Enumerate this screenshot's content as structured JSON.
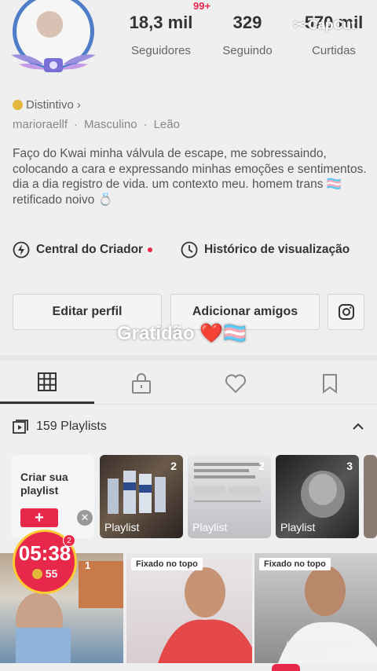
{
  "header": {
    "notification_badge": "99+",
    "watermark": "CapCut",
    "stats": [
      {
        "value": "18,3 mil",
        "label": "Seguidores"
      },
      {
        "value": "329",
        "label": "Seguindo"
      },
      {
        "value": "570 mil",
        "label": "Curtidas"
      }
    ]
  },
  "profile": {
    "badge_label": "Distintivo",
    "username": "marioraellf",
    "gender": "Masculino",
    "sign": "Leão",
    "bio": "Faço do Kwai  minha válvula de escape, me sobressaindo, colocando a cara e expressando minhas emoções e sentimentos.\ndia a dia registro de vida. um contexto meu. homem trans 🏳️‍⚧️ retificado noivo 💍"
  },
  "links": {
    "creator_center": "Central do Criador",
    "history": "Histórico de visualização"
  },
  "buttons": {
    "edit_profile": "Editar perfil",
    "add_friends": "Adicionar amigos"
  },
  "overlay_text": "Gratidão ❤️🏳️‍⚧️",
  "tabs": [
    "grid-icon",
    "lock-icon",
    "heart-icon",
    "bookmark-icon"
  ],
  "playlists": {
    "title": "159 Playlists",
    "create_label": "Criar sua playlist",
    "items": [
      {
        "count": "2",
        "label": "Playlist"
      },
      {
        "count": "2",
        "label": "Playlist"
      },
      {
        "count": "3",
        "label": "Playlist"
      }
    ]
  },
  "videos": {
    "pinned_label": "Fixado no topo",
    "caption": "Um brinde a sua resistência,",
    "first_count": "1"
  },
  "timer": {
    "time": "05:38",
    "coins": "55",
    "badge": "2"
  },
  "colors": {
    "accent": "#e8284a",
    "ring": "#4f7dc9"
  }
}
